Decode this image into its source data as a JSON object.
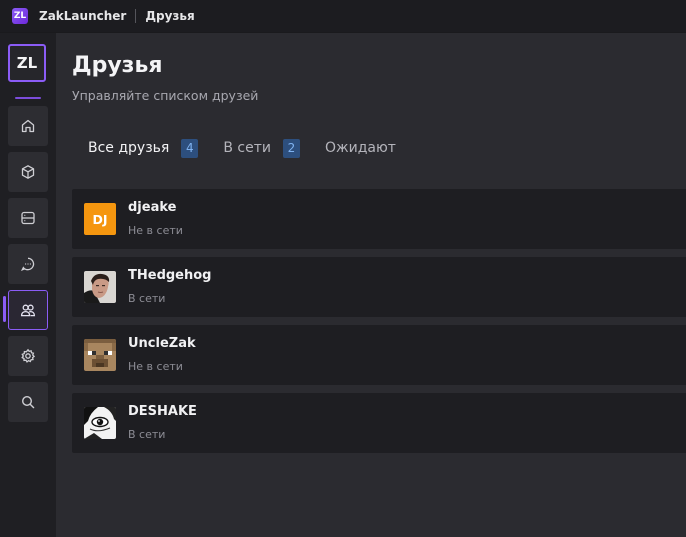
{
  "window": {
    "logo_text": "ZL",
    "app_name": "ZakLauncher",
    "page_name": "Друзья"
  },
  "sidebar": {
    "logo_text": "ZL",
    "items": [
      {
        "icon": "home-icon",
        "active": false
      },
      {
        "icon": "cube-icon",
        "active": false
      },
      {
        "icon": "server-icon",
        "active": false
      },
      {
        "icon": "chat-icon",
        "active": false
      },
      {
        "icon": "friends-icon",
        "active": true
      },
      {
        "icon": "gear-icon",
        "active": false
      },
      {
        "icon": "search-icon",
        "active": false
      }
    ]
  },
  "page": {
    "title": "Друзья",
    "subtitle": "Управляйте списком друзей"
  },
  "tabs": [
    {
      "label": "Все друзья",
      "count": "4",
      "active": true
    },
    {
      "label": "В сети",
      "count": "2",
      "active": false
    },
    {
      "label": "Ожидают",
      "count": null,
      "active": false
    }
  ],
  "friends": [
    {
      "name": "djeake",
      "status": "Не в сети",
      "avatar": "initials",
      "initials": "DJ"
    },
    {
      "name": "THedgehog",
      "status": "В сети",
      "avatar": "photo"
    },
    {
      "name": "UncleZak",
      "status": "Не в сети",
      "avatar": "pixel-skin"
    },
    {
      "name": "DESHAKE",
      "status": "В сети",
      "avatar": "sketch"
    }
  ],
  "colors": {
    "accent": "#8b5cf6",
    "background": "#2b2b30",
    "sidebar": "#1f1f23",
    "row": "#1e1e22",
    "badge_bg": "#2d4f7e",
    "badge_text": "#7fb2f0",
    "initials_avatar": "#f5960f"
  }
}
